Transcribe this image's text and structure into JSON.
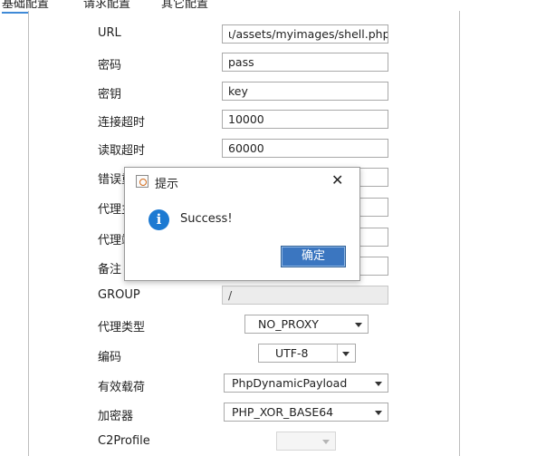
{
  "tabs": [
    {
      "label": "基础配置",
      "active": true
    },
    {
      "label": "请求配置",
      "active": false
    },
    {
      "label": "其它配置",
      "active": false
    }
  ],
  "form": {
    "url_label": "URL",
    "url_value": "ι/assets/myimages/shell.php",
    "password_label": "密码",
    "password_value": "pass",
    "key_label": "密钥",
    "key_value": "key",
    "connect_timeout_label": "连接超时",
    "connect_timeout_value": "10000",
    "read_timeout_label": "读取超时",
    "read_timeout_value": "60000",
    "retry_label_visible": "错误重",
    "proxy_host_label_visible": "代理主",
    "proxy_port_label_visible": "代理端",
    "remark_label": "备注",
    "group_label": "GROUP",
    "group_value": "/",
    "proxy_type_label": "代理类型",
    "proxy_type_value": "NO_PROXY",
    "encoding_label": "编码",
    "encoding_value": "UTF-8",
    "payload_label": "有效载荷",
    "payload_value": "PhpDynamicPayload",
    "encryptor_label": "加密器",
    "encryptor_value": "PHP_XOR_BASE64",
    "c2profile_label": "C2Profile",
    "c2profile_value": ""
  },
  "dialog": {
    "title": "提示",
    "close_glyph": "✕",
    "info_glyph": "i",
    "message": "Success!",
    "ok_label": "确定"
  }
}
